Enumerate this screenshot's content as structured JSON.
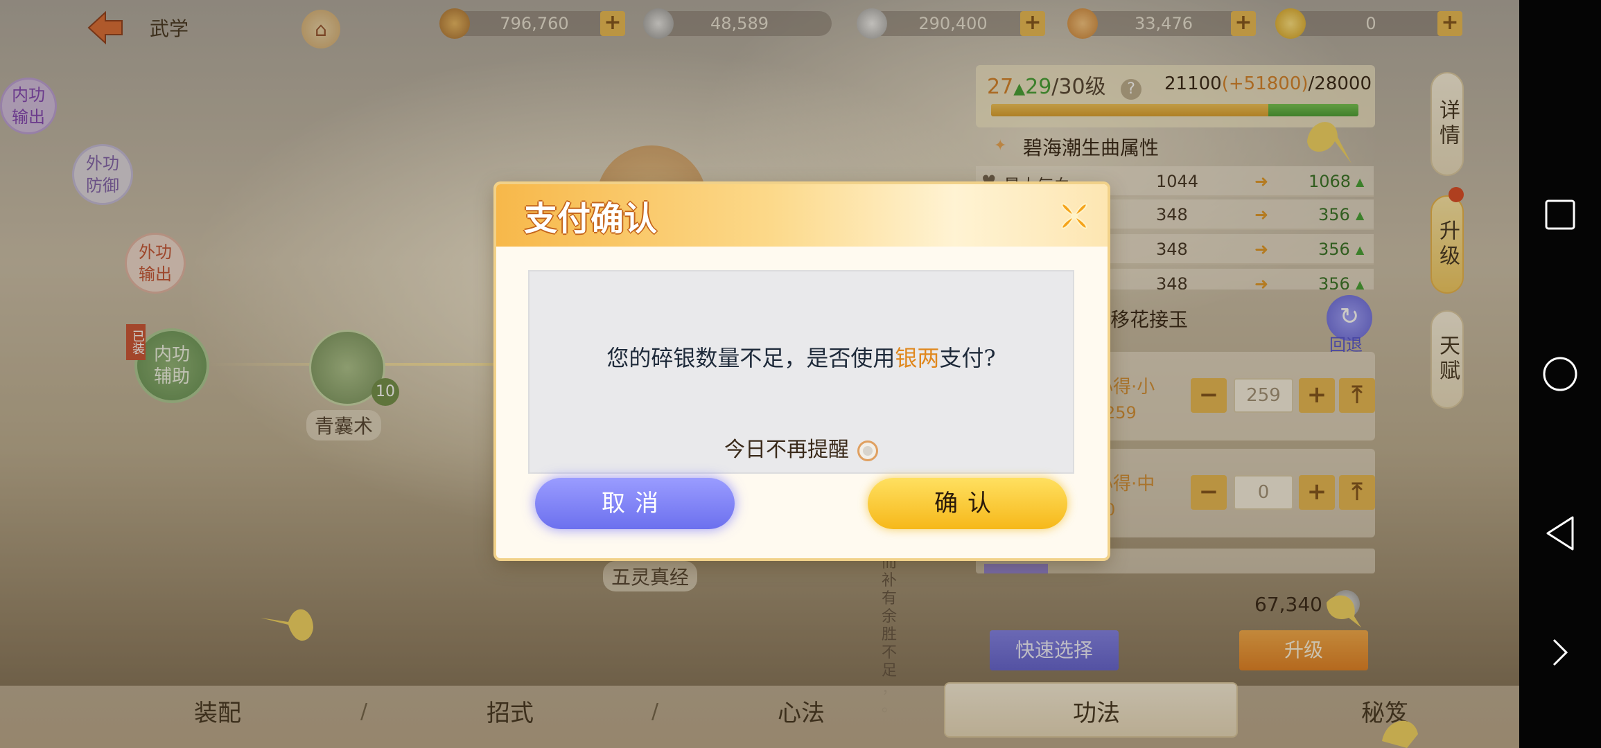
{
  "header": {
    "title": "武学"
  },
  "resources": [
    {
      "name": "copper-coin",
      "value": "796,760",
      "color": "#c98a3a"
    },
    {
      "name": "silver-bead",
      "value": "48,589",
      "color": "#b8b8b8"
    },
    {
      "name": "silver-ingot",
      "value": "290,400",
      "color": "#c9c9c9"
    },
    {
      "name": "pig-token",
      "value": "33,476",
      "color": "#e6a24a"
    },
    {
      "name": "gold-ingot",
      "value": "0",
      "color": "#f2c230"
    }
  ],
  "skill_tree": {
    "nodes": [
      {
        "label": "内功\n输出"
      },
      {
        "label": "外功\n防御"
      },
      {
        "label": "外功\n输出"
      },
      {
        "label": "内功\n辅助"
      }
    ],
    "equipped_tag": "已装",
    "skill_level": "10",
    "skill_names": [
      "青囊术",
      "五灵真经"
    ],
    "quote": "而补有余，胜不足",
    "quote_lines": [
      "而",
      "补",
      "有",
      "余",
      "胜",
      "不",
      "足",
      "，",
      "。"
    ]
  },
  "level": {
    "current": "27",
    "up_arrow": "▲",
    "target": "29",
    "max_label": "/30级",
    "exp_current": "21100",
    "exp_add": "(+51800)",
    "exp_max": "/28000",
    "exp_ratio": 0.754,
    "exp_add_ratio": 0.246
  },
  "attributes": {
    "title": "碧海潮生曲属性",
    "rows": [
      {
        "name": "最大气血",
        "old": "1044",
        "new": "1068"
      },
      {
        "name": "",
        "old": "348",
        "new": "356"
      },
      {
        "name": "",
        "old": "348",
        "new": "356"
      },
      {
        "name": "",
        "old": "348",
        "new": "356"
      }
    ]
  },
  "side_tabs": [
    "详情",
    "升级",
    "天赋"
  ],
  "materials": {
    "section_title": "移花接玉",
    "undo_label": "回退",
    "items": [
      {
        "name": "心得·小",
        "owned": "259",
        "qty": "259"
      },
      {
        "name": "心得·中",
        "owned": "0",
        "qty": "0"
      }
    ]
  },
  "footer": {
    "coin_count": "67,340",
    "quick_select": "快速选择",
    "upgrade": "升级"
  },
  "bottom_tabs": [
    "装配",
    "招式",
    "心法",
    "功法",
    "秘笈"
  ],
  "active_bottom_tab": "功法",
  "dialog": {
    "title": "支付确认",
    "message_pre": "您的碎银数量不足，是否使用",
    "message_highlight": "银两",
    "message_post": "支付?",
    "remind_label": "今日不再提醒",
    "cancel_label": "取消",
    "confirm_label": "确认"
  }
}
